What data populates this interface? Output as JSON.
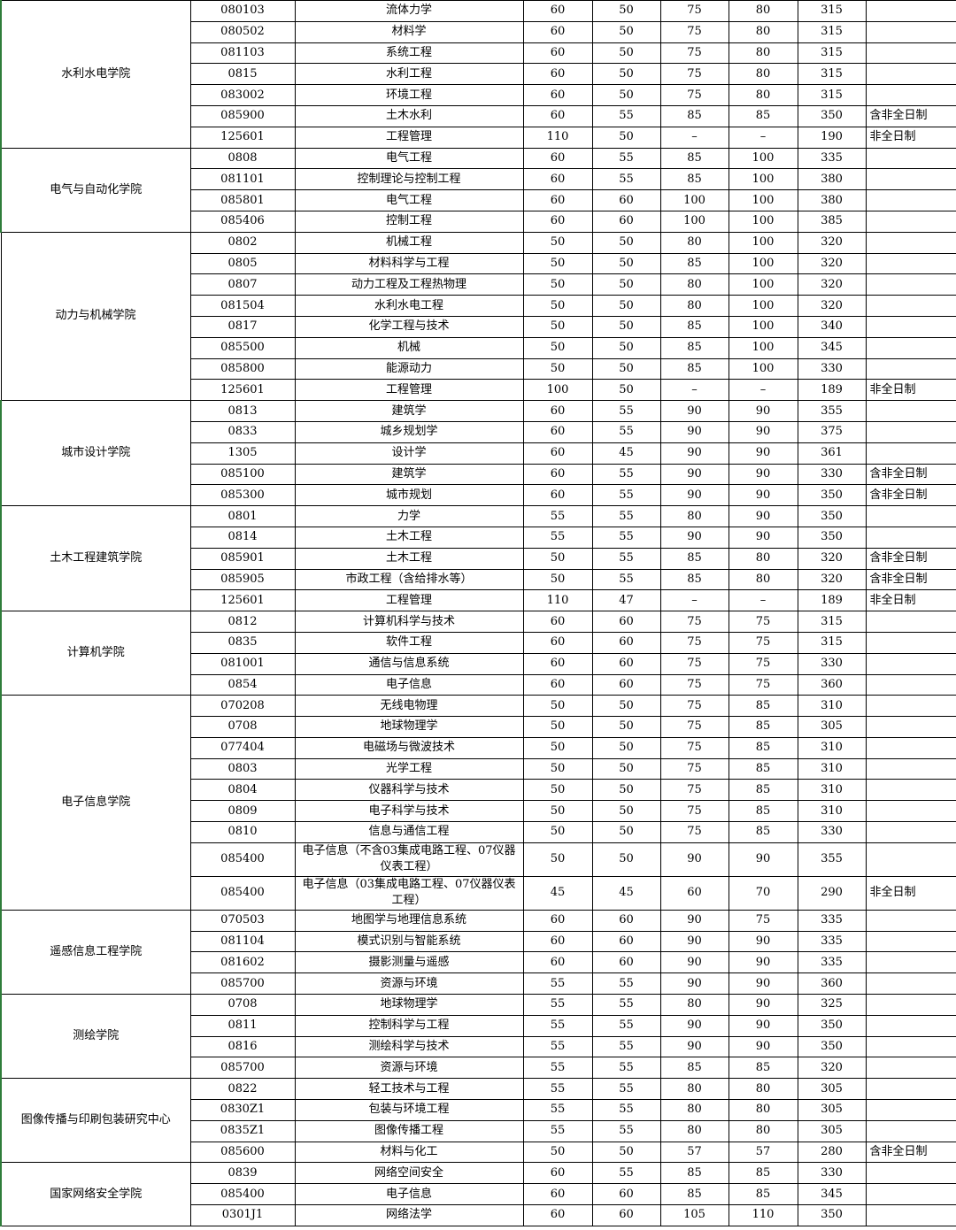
{
  "groups": [
    {
      "name": "水利水电学院",
      "rows": [
        [
          "080103",
          "流体力学",
          "60",
          "50",
          "75",
          "80",
          "315",
          ""
        ],
        [
          "080502",
          "材料学",
          "60",
          "50",
          "75",
          "80",
          "315",
          ""
        ],
        [
          "081103",
          "系统工程",
          "60",
          "50",
          "75",
          "80",
          "315",
          ""
        ],
        [
          "0815",
          "水利工程",
          "60",
          "50",
          "75",
          "80",
          "315",
          ""
        ],
        [
          "083002",
          "环境工程",
          "60",
          "50",
          "75",
          "80",
          "315",
          ""
        ],
        [
          "085900",
          "土木水利",
          "60",
          "55",
          "85",
          "85",
          "350",
          "含非全日制"
        ],
        [
          "125601",
          "工程管理",
          "110",
          "50",
          "–",
          "–",
          "190",
          "非全日制"
        ]
      ]
    },
    {
      "name": "电气与自动化学院",
      "rows": [
        [
          "0808",
          "电气工程",
          "60",
          "55",
          "85",
          "100",
          "335",
          ""
        ],
        [
          "081101",
          "控制理论与控制工程",
          "60",
          "55",
          "85",
          "100",
          "380",
          ""
        ],
        [
          "085801",
          "电气工程",
          "60",
          "60",
          "100",
          "100",
          "380",
          ""
        ],
        [
          "085406",
          "控制工程",
          "60",
          "60",
          "100",
          "100",
          "385",
          ""
        ]
      ]
    },
    {
      "name": "动力与机械学院",
      "rows": [
        [
          "0802",
          "机械工程",
          "50",
          "50",
          "80",
          "100",
          "320",
          ""
        ],
        [
          "0805",
          "材料科学与工程",
          "50",
          "50",
          "85",
          "100",
          "320",
          ""
        ],
        [
          "0807",
          "动力工程及工程热物理",
          "50",
          "50",
          "80",
          "100",
          "320",
          ""
        ],
        [
          "081504",
          "水利水电工程",
          "50",
          "50",
          "80",
          "100",
          "320",
          ""
        ],
        [
          "0817",
          "化学工程与技术",
          "50",
          "50",
          "85",
          "100",
          "340",
          ""
        ],
        [
          "085500",
          "机械",
          "50",
          "50",
          "85",
          "100",
          "345",
          ""
        ],
        [
          "085800",
          "能源动力",
          "50",
          "50",
          "85",
          "100",
          "330",
          ""
        ],
        [
          "125601",
          "工程管理",
          "100",
          "50",
          "–",
          "–",
          "189",
          "非全日制"
        ]
      ]
    },
    {
      "name": "城市设计学院",
      "rows": [
        [
          "0813",
          "建筑学",
          "60",
          "55",
          "90",
          "90",
          "355",
          ""
        ],
        [
          "0833",
          "城乡规划学",
          "60",
          "55",
          "90",
          "90",
          "375",
          ""
        ],
        [
          "1305",
          "设计学",
          "60",
          "45",
          "90",
          "90",
          "361",
          ""
        ],
        [
          "085100",
          "建筑学",
          "60",
          "55",
          "90",
          "90",
          "330",
          "含非全日制"
        ],
        [
          "085300",
          "城市规划",
          "60",
          "55",
          "90",
          "90",
          "350",
          "含非全日制"
        ]
      ]
    },
    {
      "name": "土木工程建筑学院",
      "rows": [
        [
          "0801",
          "力学",
          "55",
          "55",
          "80",
          "90",
          "350",
          ""
        ],
        [
          "0814",
          "土木工程",
          "55",
          "55",
          "90",
          "90",
          "350",
          ""
        ],
        [
          "085901",
          "土木工程",
          "50",
          "55",
          "85",
          "80",
          "320",
          "含非全日制"
        ],
        [
          "085905",
          "市政工程（含给排水等）",
          "50",
          "55",
          "85",
          "80",
          "320",
          "含非全日制"
        ],
        [
          "125601",
          "工程管理",
          "110",
          "47",
          "–",
          "–",
          "189",
          "非全日制"
        ]
      ]
    },
    {
      "name": "计算机学院",
      "rows": [
        [
          "0812",
          "计算机科学与技术",
          "60",
          "60",
          "75",
          "75",
          "315",
          ""
        ],
        [
          "0835",
          "软件工程",
          "60",
          "60",
          "75",
          "75",
          "315",
          ""
        ],
        [
          "081001",
          "通信与信息系统",
          "60",
          "60",
          "75",
          "75",
          "330",
          ""
        ],
        [
          "0854",
          "电子信息",
          "60",
          "60",
          "75",
          "75",
          "360",
          ""
        ]
      ]
    },
    {
      "name": "电子信息学院",
      "rows": [
        [
          "070208",
          "无线电物理",
          "50",
          "50",
          "75",
          "85",
          "310",
          ""
        ],
        [
          "0708",
          "地球物理学",
          "50",
          "50",
          "75",
          "85",
          "305",
          ""
        ],
        [
          "077404",
          "电磁场与微波技术",
          "50",
          "50",
          "75",
          "85",
          "310",
          ""
        ],
        [
          "0803",
          "光学工程",
          "50",
          "50",
          "75",
          "85",
          "310",
          ""
        ],
        [
          "0804",
          "仪器科学与技术",
          "50",
          "50",
          "75",
          "85",
          "310",
          ""
        ],
        [
          "0809",
          "电子科学与技术",
          "50",
          "50",
          "75",
          "85",
          "310",
          ""
        ],
        [
          "0810",
          "信息与通信工程",
          "50",
          "50",
          "75",
          "85",
          "330",
          ""
        ],
        [
          "085400",
          "电子信息（不含03集成电路工程、07仪器仪表工程）",
          "50",
          "50",
          "90",
          "90",
          "355",
          ""
        ],
        [
          "085400",
          "电子信息（03集成电路工程、07仪器仪表工程）",
          "45",
          "45",
          "60",
          "70",
          "290",
          "非全日制"
        ]
      ]
    },
    {
      "name": "遥感信息工程学院",
      "rows": [
        [
          "070503",
          "地图学与地理信息系统",
          "60",
          "60",
          "90",
          "75",
          "335",
          ""
        ],
        [
          "081104",
          "模式识别与智能系统",
          "60",
          "60",
          "90",
          "90",
          "335",
          ""
        ],
        [
          "081602",
          "摄影测量与遥感",
          "60",
          "60",
          "90",
          "90",
          "335",
          ""
        ],
        [
          "085700",
          "资源与环境",
          "55",
          "55",
          "90",
          "90",
          "360",
          ""
        ]
      ]
    },
    {
      "name": "测绘学院",
      "rows": [
        [
          "0708",
          "地球物理学",
          "55",
          "55",
          "80",
          "90",
          "325",
          ""
        ],
        [
          "0811",
          "控制科学与工程",
          "55",
          "55",
          "90",
          "90",
          "350",
          ""
        ],
        [
          "0816",
          "测绘科学与技术",
          "55",
          "55",
          "90",
          "90",
          "350",
          ""
        ],
        [
          "085700",
          "资源与环境",
          "55",
          "55",
          "85",
          "85",
          "320",
          ""
        ]
      ]
    },
    {
      "name": "图像传播与印刷包装研究中心",
      "rows": [
        [
          "0822",
          "轻工技术与工程",
          "55",
          "55",
          "80",
          "80",
          "305",
          ""
        ],
        [
          "0830Z1",
          "包装与环境工程",
          "55",
          "55",
          "80",
          "80",
          "305",
          ""
        ],
        [
          "0835Z1",
          "图像传播工程",
          "55",
          "55",
          "80",
          "80",
          "305",
          ""
        ],
        [
          "085600",
          "材料与化工",
          "50",
          "50",
          "57",
          "57",
          "280",
          "含非全日制"
        ]
      ]
    },
    {
      "name": "国家网络安全学院",
      "rows": [
        [
          "0839",
          "网络空间安全",
          "60",
          "55",
          "85",
          "85",
          "330",
          ""
        ],
        [
          "085400",
          "电子信息",
          "60",
          "60",
          "85",
          "85",
          "345",
          ""
        ],
        [
          "0301J1",
          "网络法学",
          "60",
          "60",
          "105",
          "110",
          "350",
          ""
        ]
      ]
    }
  ]
}
